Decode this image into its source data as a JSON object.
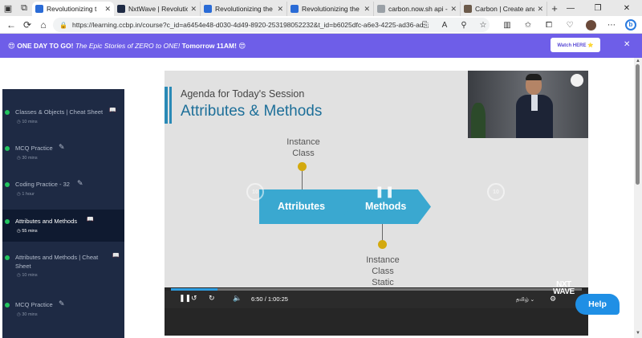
{
  "browser": {
    "tabs": [
      {
        "title": "Revolutionizing t",
        "favicon_color": "#2a6bd6",
        "active": true
      },
      {
        "title": "NxtWave | Revolution",
        "favicon_color": "#1e2a44",
        "active": false
      },
      {
        "title": "Revolutionizing the Jo",
        "favicon_color": "#2a6bd6",
        "active": false
      },
      {
        "title": "Revolutionizing the Jo",
        "favicon_color": "#2a6bd6",
        "active": false
      },
      {
        "title": "carbon.now.sh api - Se",
        "favicon_color": "#9aa0a6",
        "active": false
      },
      {
        "title": "Carbon | Create and sh",
        "favicon_color": "#6b5a4a",
        "active": false
      }
    ],
    "url": "https://learning.ccbp.in/course?c_id=a6454e48-d030-4d49-8920-253198052232&t_id=b6025dfc-a6e3-4225-ad36-ad..."
  },
  "banner": {
    "emoji_left": "😍",
    "emoji_right": "😍",
    "bold_text": "ONE DAY TO GO!",
    "italic_text": "The Epic Stories of ZERO to ONE!",
    "bold_tail": "Tomorrow 11AM!",
    "button_label": "Watch HERE ⭐",
    "background_color": "#6e5ee8"
  },
  "sidebar": {
    "items": [
      {
        "title": "Classes & Objects | Cheat Sheet",
        "icon": "book-icon",
        "time": "10 mins",
        "active": false
      },
      {
        "title": "MCQ Practice",
        "icon": "pencil-icon",
        "time": "30 mins",
        "active": false
      },
      {
        "title": "Coding Practice - 32",
        "icon": "pencil-icon",
        "time": "1 hour",
        "active": false
      },
      {
        "title": "Attributes and Methods",
        "icon": "book-icon",
        "time": "55 mins",
        "active": true
      },
      {
        "title": "Attributes and Methods | Cheat Sheet",
        "icon": "book-icon",
        "time": "10 mins",
        "active": false
      },
      {
        "title": "MCQ Practice",
        "icon": "pencil-icon",
        "time": "30 mins",
        "active": false
      }
    ]
  },
  "video": {
    "agenda": "Agenda for Today's Session",
    "title": "Attributes & Methods",
    "top_caption": "Instance\nClass",
    "bottom_caption": "Instance\nClass\nStatic",
    "arrow_left_label": "Attributes",
    "arrow_right_label": "Methods",
    "replay_back_label": "10",
    "replay_fwd_label": "10",
    "current_time": "6:50",
    "duration": "1:00:25",
    "time_separator": "/",
    "progress_fraction": 0.1132,
    "language": "தமிழ்",
    "brand_line1": "NXT",
    "brand_line2": "WAVE"
  },
  "help": {
    "label": "Help"
  }
}
